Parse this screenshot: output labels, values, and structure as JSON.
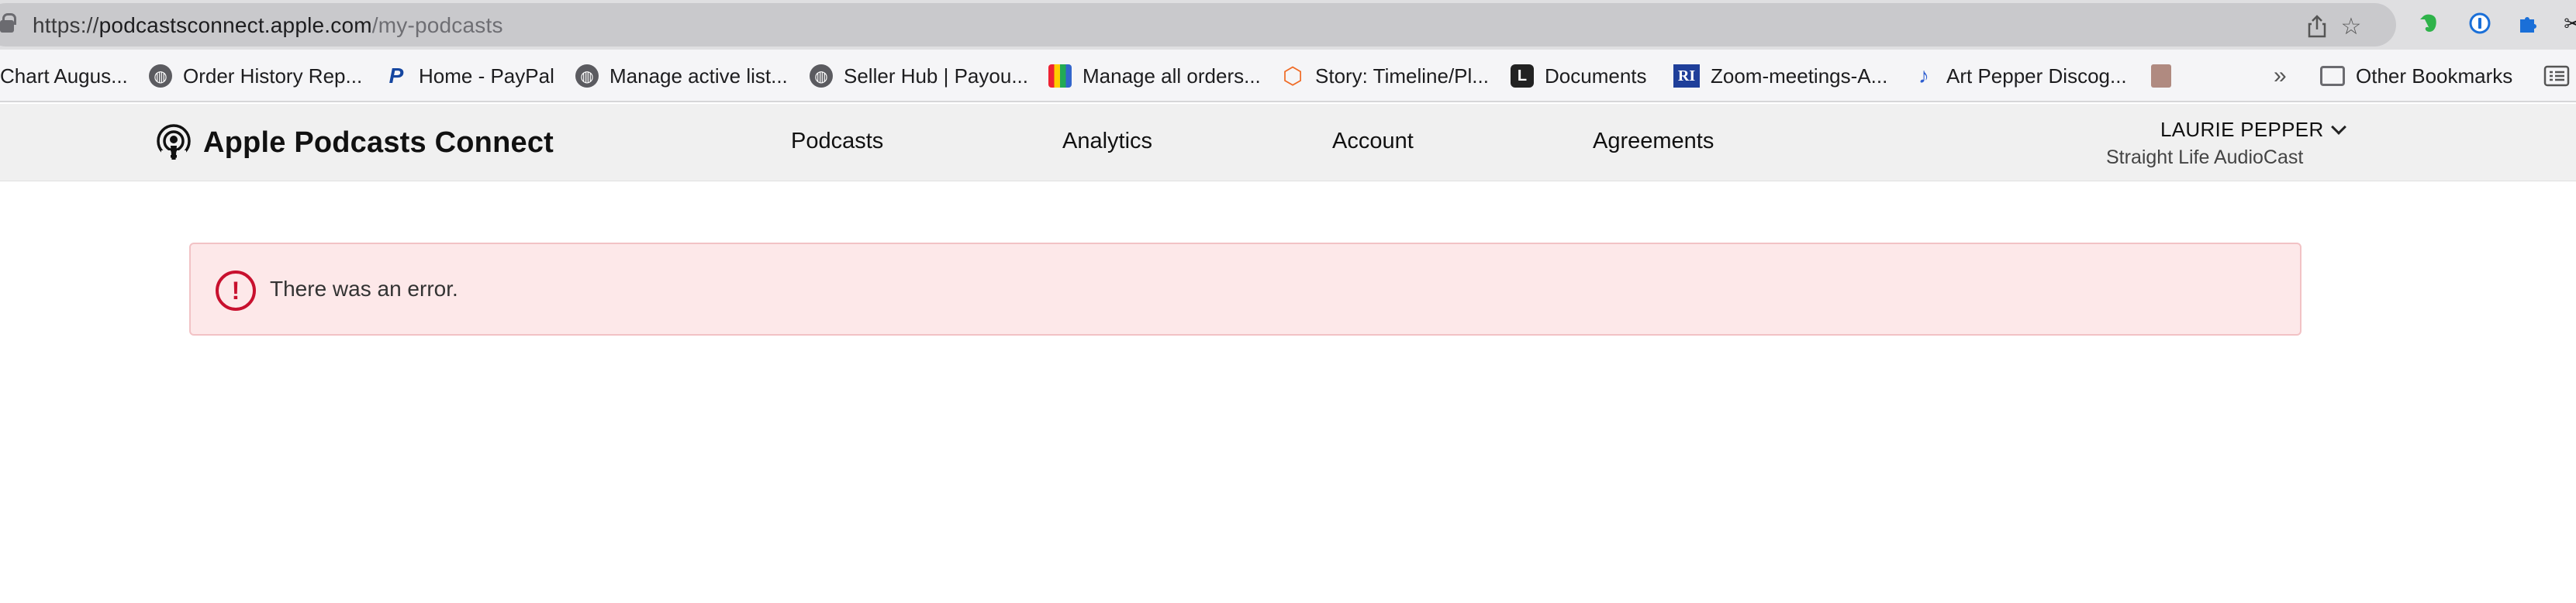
{
  "browser": {
    "url_prefix": "https://",
    "url_host": "podcastsconnect.apple.com",
    "url_path": "/my-podcasts",
    "actions": [
      "share-icon",
      "bookmark-star-icon"
    ],
    "extensions": [
      "evernote-icon",
      "onepassword-icon",
      "puzzle-extensions-icon",
      "tools-icon"
    ]
  },
  "bookmarks": {
    "items": [
      {
        "label": "Chart Augus...",
        "icon": "none"
      },
      {
        "label": "Order History Rep...",
        "icon": "globe-icon"
      },
      {
        "label": "Home - PayPal",
        "icon": "paypal-icon"
      },
      {
        "label": "Manage active list...",
        "icon": "globe-icon"
      },
      {
        "label": "Seller Hub | Payou...",
        "icon": "globe-icon"
      },
      {
        "label": "Manage all orders...",
        "icon": "shopping-bag-icon"
      },
      {
        "label": "Story: Timeline/Pl...",
        "icon": "story-icon"
      },
      {
        "label": "Documents",
        "icon": "documents-icon"
      },
      {
        "label": "Zoom-meetings-A...",
        "icon": "ri-icon"
      },
      {
        "label": "Art Pepper Discog...",
        "icon": "saxophone-icon"
      }
    ],
    "overflow": "»",
    "other": "Other Bookmarks"
  },
  "header": {
    "brand": "Apple Podcasts Connect",
    "nav": [
      "Podcasts",
      "Analytics",
      "Account",
      "Agreements"
    ],
    "user_name": "LAURIE PEPPER",
    "user_sub": "Straight Life AudioCast"
  },
  "error": {
    "icon": "!",
    "message": "There was an error."
  },
  "colors": {
    "error_bg": "#fde8e9",
    "error_border": "#f2c2c5",
    "error_icon": "#c8102e",
    "header_bg": "#f0f0f0"
  }
}
